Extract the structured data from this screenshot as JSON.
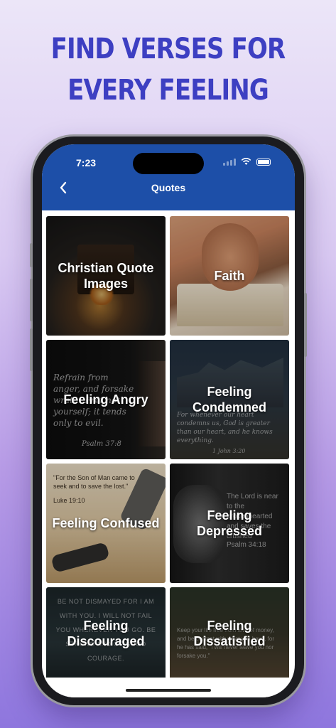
{
  "headline": {
    "line1": "FIND VERSES FOR",
    "line2": "EVERY FEELING"
  },
  "status": {
    "time": "7:23"
  },
  "header": {
    "title": "Quotes",
    "back_icon": "chevron-left-icon"
  },
  "tiles": [
    {
      "label": "Christian Quote Images"
    },
    {
      "label": "Faith"
    },
    {
      "label": "Feeling Angry"
    },
    {
      "label": "Feeling Condemned"
    },
    {
      "label": "Feeling Confused"
    },
    {
      "label": "Feeling Depressed"
    },
    {
      "label": "Feeling Discouraged"
    },
    {
      "label": "Feeling Dissatisfied"
    }
  ],
  "tile_verses": {
    "angry": "Refrain from anger, and forsake wrath! Fret not yourself; it tends only to evil.",
    "angry_ref": "Psalm 37:8",
    "condemned": "For whenever our heart condemns us, God is greater than our heart, and he knows everything.",
    "condemned_ref": "1 John 3:20",
    "confused": "\"For the Son of Man came to seek and to save the lost.\"",
    "confused_ref": "Luke 19:10",
    "depressed": "The Lord is near to the brokenhearted and saves the crushed",
    "depressed_ref": "Psalm 34:18",
    "discouraged": "BE NOT DISMAYED FOR I AM WITH YOU. I WILL NOT FAIL YOU WHEREVER YOU GO. BE STRONG AND OF GOOD COURAGE.",
    "dissatisfied": "Keep your life free from love of money, and be content with what you have, for he has said, \"I will never leave you nor forsake you.\""
  },
  "colors": {
    "headline": "#3d3fc2",
    "topbar": "#1d4fa8"
  }
}
